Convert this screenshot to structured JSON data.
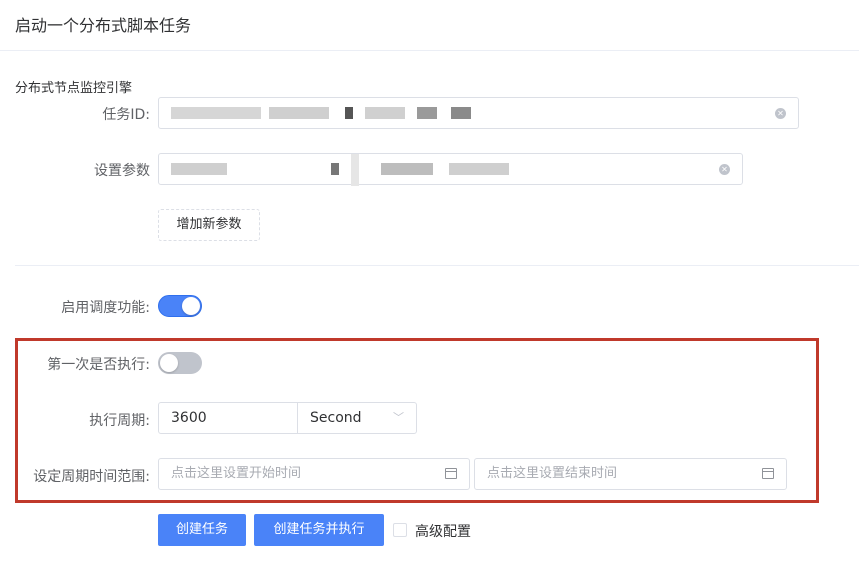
{
  "header": {
    "title": "启动一个分布式脚本任务"
  },
  "engine": {
    "section_label": "分布式节点监控引擎",
    "task_id_label": "任务ID:",
    "task_id_value": "",
    "params_label": "设置参数",
    "params_value": "",
    "add_param_label": "增加新参数"
  },
  "schedule": {
    "enable_label": "启用调度功能:",
    "enabled": true,
    "first_run_label": "第一次是否执行:",
    "first_run": false,
    "period_label": "执行周期:",
    "period_value": "3600",
    "period_unit": "Second",
    "range_label": "设定周期时间范围:",
    "start_placeholder": "点击这里设置开始时间",
    "end_placeholder": "点击这里设置结束时间"
  },
  "actions": {
    "create_label": "创建任务",
    "create_run_label": "创建任务并执行",
    "advanced_label": "高级配置"
  },
  "colors": {
    "primary": "#4a83f8",
    "highlight_border": "#c0392b"
  }
}
